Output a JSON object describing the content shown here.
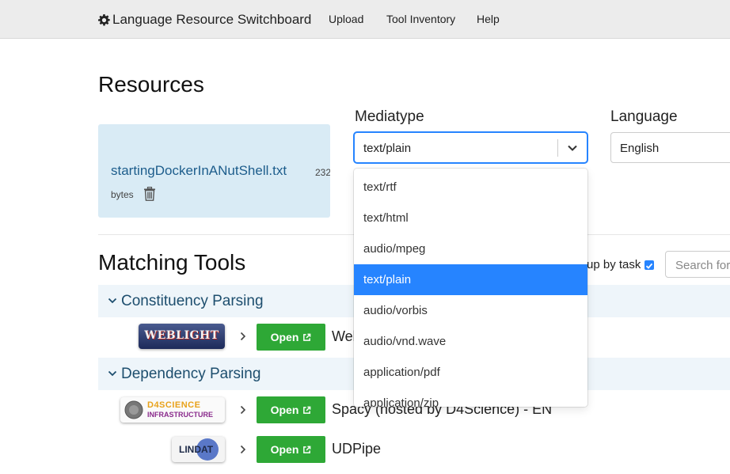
{
  "nav": {
    "brand": "Language Resource Switchboard",
    "links": [
      "Upload",
      "Tool Inventory",
      "Help"
    ]
  },
  "resources": {
    "heading": "Resources",
    "file_name": "startingDockerInANutShell.txt",
    "size_number": "232",
    "size_unit": "bytes",
    "delete_icon": "trash-icon"
  },
  "filters": {
    "mediatype_label": "Mediatype",
    "mediatype_value": "text/plain",
    "language_label": "Language",
    "language_value": "English",
    "options": [
      "text/rtf",
      "text/html",
      "audio/mpeg",
      "text/plain",
      "audio/vorbis",
      "audio/vnd.wave",
      "application/pdf",
      "application/zip"
    ],
    "selected_index": 3
  },
  "matching": {
    "heading": "Matching Tools",
    "group_by_label": "up by task",
    "group_by_checked": true,
    "search_placeholder": "Search for",
    "groups": [
      {
        "title": "Constituency Parsing",
        "tools": [
          {
            "logo": "WEBLIGHT",
            "open_label": "Open",
            "name": "Web"
          }
        ]
      },
      {
        "title": "Dependency Parsing",
        "tools": [
          {
            "logo_line1": "D4SCIENCE",
            "logo_line2": "INFRASTRUCTURE",
            "open_label": "Open",
            "name": "Spacy (hosted by D4Science) - EN"
          },
          {
            "logo": "LINDAT",
            "open_label": "Open",
            "name": "UDPipe"
          }
        ]
      }
    ]
  },
  "colors": {
    "accent": "#2684ff",
    "open_button": "#2ea836",
    "link": "#1d5d8c",
    "card_bg": "#d9ebf5"
  }
}
